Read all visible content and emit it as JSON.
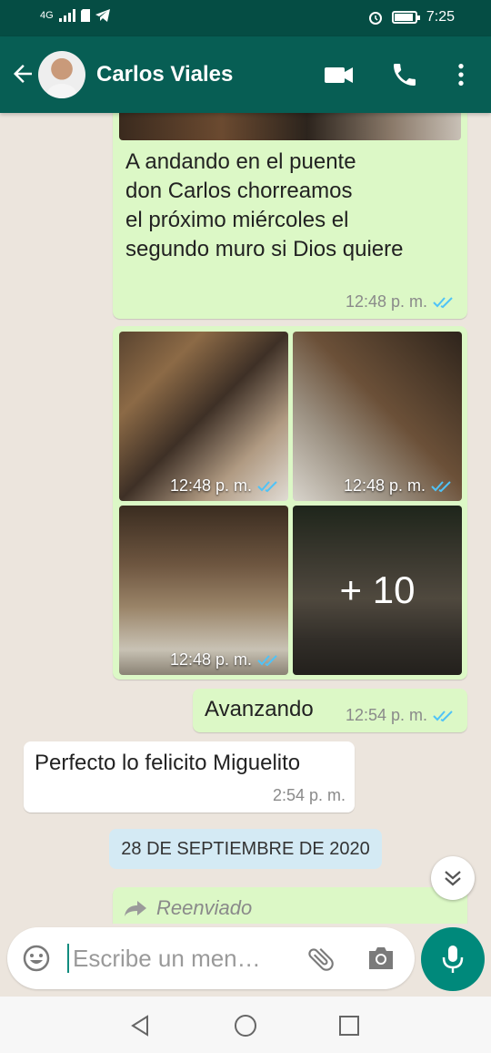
{
  "status_bar": {
    "network": "4G",
    "time": "7:25",
    "battery_level": 0.9
  },
  "header": {
    "contact_name": "Carlos Viales",
    "icons": [
      "back-arrow-icon",
      "video-call-icon",
      "voice-call-icon",
      "more-vert-icon"
    ]
  },
  "messages": [
    {
      "type": "outgoing-text",
      "text_lines": [
        "A andando en el puente",
        "don Carlos chorreamos",
        "el próximo miércoles el",
        "segundo muro si Dios quiere"
      ],
      "time": "12:48 p. m."
    },
    {
      "type": "outgoing-photo-grid",
      "photos": [
        {
          "time": "12:48 p. m."
        },
        {
          "time": "12:48 p. m."
        },
        {
          "time": "12:48 p. m."
        },
        {
          "overlay": "+ 10"
        }
      ]
    },
    {
      "type": "outgoing-text",
      "text": "Avanzando",
      "time": "12:54 p. m."
    },
    {
      "type": "incoming-text",
      "text": "Perfecto lo felicito Miguelito",
      "time": "2:54 p. m."
    },
    {
      "type": "date-divider",
      "text": "28 DE SEPTIEMBRE DE 2020"
    },
    {
      "type": "outgoing-forwarded",
      "label": "Reenviado"
    }
  ],
  "composer": {
    "placeholder": "Escribe un men…"
  },
  "colors": {
    "header": "#075e54",
    "status_bar": "#054d44",
    "outgoing": "#dcf8c6",
    "incoming": "#ffffff",
    "read_ticks": "#4fc3f7",
    "mic": "#00897b"
  }
}
